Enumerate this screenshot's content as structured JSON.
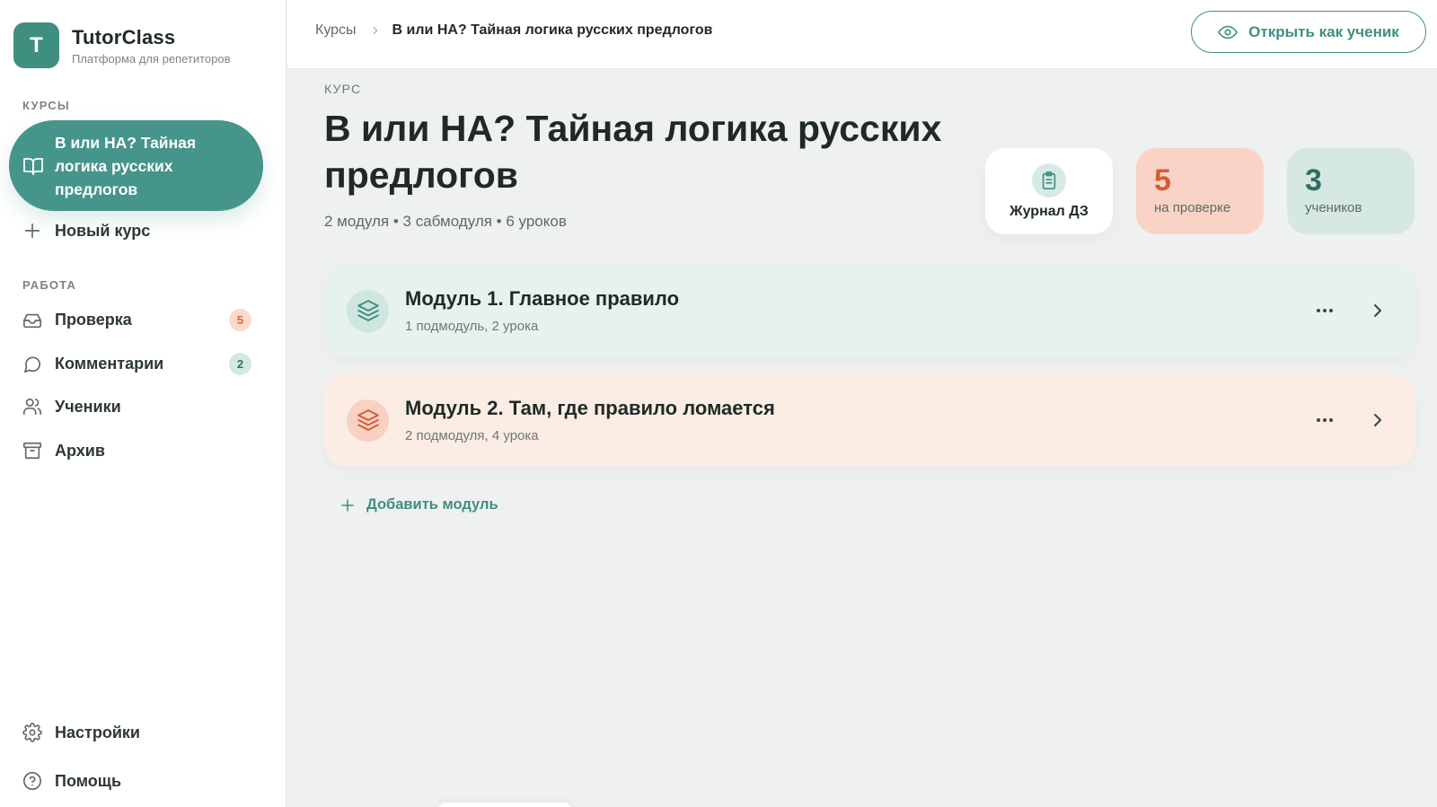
{
  "brand": {
    "logo_letter": "T",
    "name": "TutorClass",
    "subtitle": "Платформа для репетиторов"
  },
  "sidebar": {
    "courses_label": "КУРСЫ",
    "active_course": "В или НА? Тайная логика русских предлогов",
    "new_course": "Новый курс",
    "work_label": "РАБОТА",
    "items": [
      {
        "label": "Проверка",
        "icon": "inbox-icon",
        "badge": "5"
      },
      {
        "label": "Комментарии",
        "icon": "comment-icon",
        "badge": "2"
      },
      {
        "label": "Ученики",
        "icon": "users-icon"
      },
      {
        "label": "Архив",
        "icon": "archive-icon"
      }
    ],
    "settings": "Настройки",
    "help": "Помощь"
  },
  "topbar": {
    "breadcrumb_root": "Курсы",
    "breadcrumb_current": "В или НА? Тайная логика русских предлогов",
    "open_as_student": "Открыть как ученик"
  },
  "course": {
    "eyebrow": "КУРС",
    "title": "В или НА? Тайная логика русских предлогов",
    "meta": "2 модуля • 3 сабмодуля • 6 уроков"
  },
  "stats": {
    "journal_label": "Журнал ДЗ",
    "review_count": "5",
    "review_label": "на проверке",
    "students_count": "3",
    "students_label": "учеников"
  },
  "modules": [
    {
      "title": "Модуль 1. Главное правило",
      "subtitle": "1 подмодуль, 2 урока"
    },
    {
      "title": "Модуль 2. Там, где правило ломается",
      "subtitle": "2 подмодуля, 4 урока"
    }
  ],
  "add_module": "Добавить модуль",
  "colors": {
    "accent": "#3f8f80",
    "active_course_bg": "#45958a",
    "review_bg": "#f9d4c6",
    "review_text": "#d65a36",
    "students_bg": "#d6e8e2",
    "module1_bg": "#e7f1ee",
    "module2_bg": "#fbece4"
  }
}
